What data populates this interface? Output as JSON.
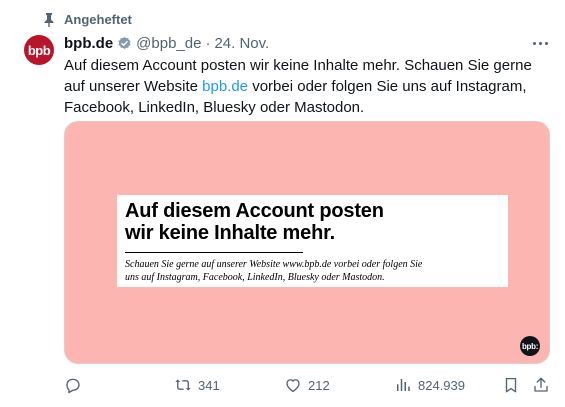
{
  "pinned": {
    "label": "Angeheftet",
    "icon": "pin-icon"
  },
  "author": {
    "avatar_text": "bpb",
    "name": "bpb.de",
    "verified_icon": "verified-badge-icon",
    "handle": "@bpb_de",
    "separator": "·",
    "date": "24. Nov."
  },
  "tweet": {
    "text_part1": "Auf diesem Account posten wir keine Inhalte mehr. Schauen Sie gerne auf unserer Website ",
    "link": "bpb.de",
    "text_part2": " vorbei oder folgen Sie uns auf Instagram, Facebook, LinkedIn, Bluesky oder Mastodon."
  },
  "media": {
    "background_color": "#fdb5b2",
    "headline_line1": "Auf diesem Account posten",
    "headline_line2": "wir keine Inhalte mehr.",
    "subtext_line1": "Schauen Sie gerne auf unserer Website www.bpb.de vorbei oder folgen Sie",
    "subtext_line2": "uns auf Instagram, Facebook, LinkedIn, Bluesky oder Mastodon.",
    "logo_text": "bpb:"
  },
  "actions": {
    "reply": {
      "icon": "reply-icon",
      "count": ""
    },
    "retweet": {
      "icon": "retweet-icon",
      "count": "341"
    },
    "like": {
      "icon": "heart-icon",
      "count": "212"
    },
    "views": {
      "icon": "views-icon",
      "count": "824.939"
    },
    "bookmark": {
      "icon": "bookmark-icon"
    },
    "share": {
      "icon": "share-icon"
    }
  },
  "colors": {
    "accent": "#1d9bf0",
    "muted": "#536471",
    "avatar": "#b8142c"
  }
}
